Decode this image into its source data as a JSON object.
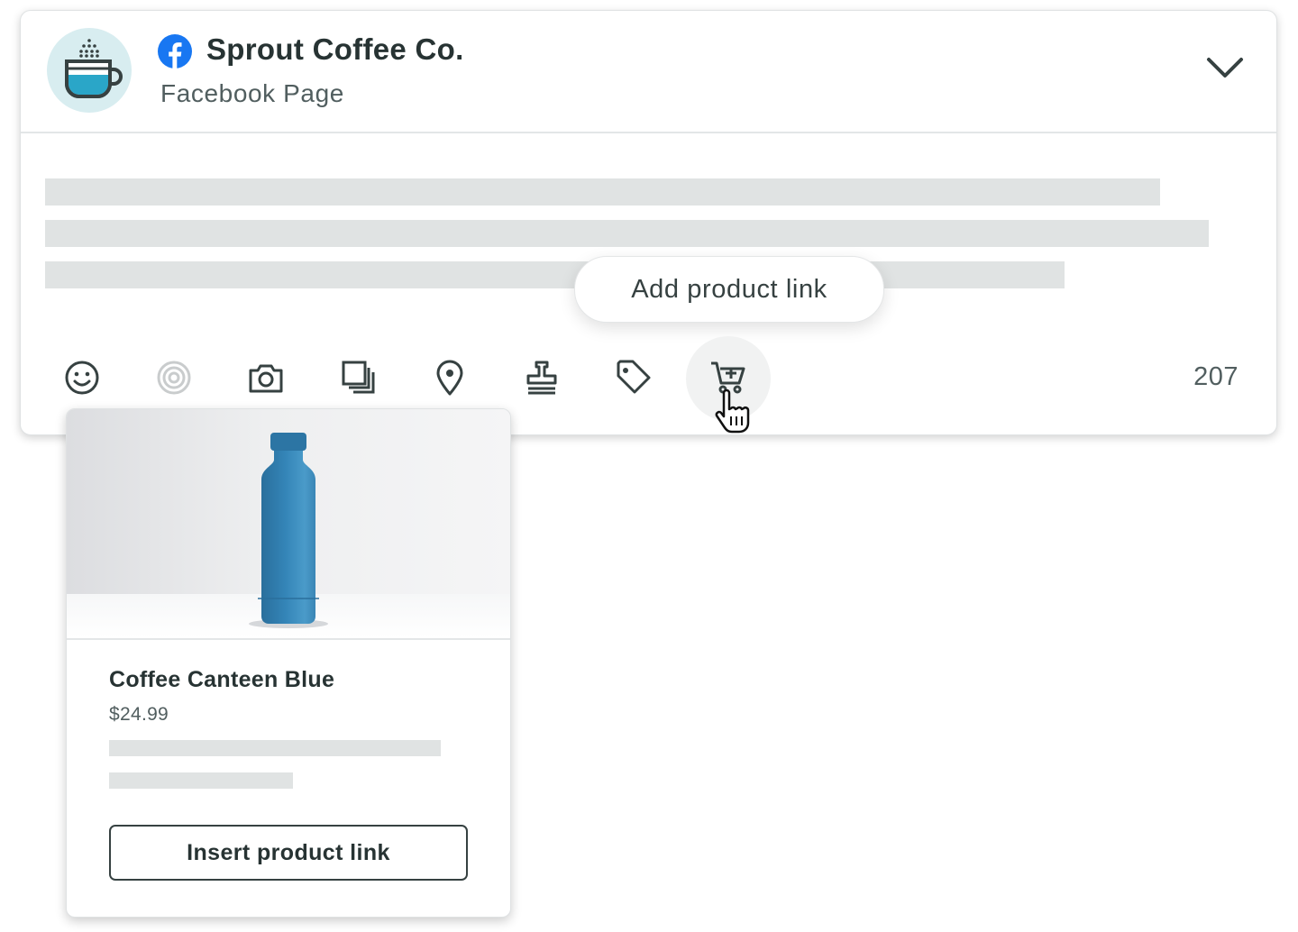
{
  "account": {
    "name": "Sprout Coffee Co.",
    "type": "Facebook Page",
    "network_icon": "facebook-icon",
    "avatar_icon": "coffee-cup-icon"
  },
  "composer": {
    "tooltip": "Add product link",
    "character_count": "207",
    "toolbar": [
      {
        "name": "emoji-icon"
      },
      {
        "name": "target-icon"
      },
      {
        "name": "camera-icon"
      },
      {
        "name": "media-library-icon"
      },
      {
        "name": "location-pin-icon"
      },
      {
        "name": "stamp-icon"
      },
      {
        "name": "tag-icon"
      },
      {
        "name": "cart-add-icon"
      }
    ]
  },
  "product": {
    "title": "Coffee Canteen Blue",
    "price": "$24.99",
    "button_label": "Insert product link",
    "image": "blue-water-bottle"
  },
  "colors": {
    "facebook_blue": "#1877f2",
    "avatar_bg": "#d8edf0",
    "cup_liquid": "#2aa6c8",
    "bottle_blue": "#2f7fb0",
    "placeholder_gray": "#e0e3e3",
    "text_dark": "#273333"
  }
}
